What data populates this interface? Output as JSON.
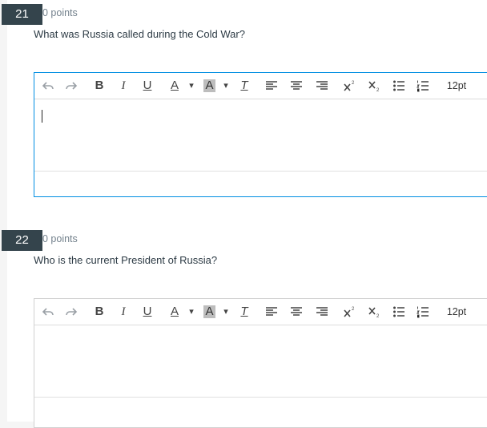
{
  "questions": [
    {
      "number": "21",
      "points": "0 points",
      "text": "What was Russia called during the Cold War?"
    },
    {
      "number": "22",
      "points": "0 points",
      "text": "Who is the current President of Russia?"
    }
  ],
  "toolbar": {
    "bold": "B",
    "italic": "I",
    "underline": "U",
    "font_color": "A",
    "background_color": "A",
    "dropdown_arrow": "▾",
    "clear_formatting": "T",
    "font_size": "12pt",
    "icons": [
      "undo-icon",
      "redo-icon",
      "align-left-icon",
      "align-center-icon",
      "align-right-icon",
      "superscript-icon",
      "subscript-icon",
      "bullet-list-icon",
      "numbered-list-icon"
    ]
  },
  "colors": {
    "active_border": "#008ee2",
    "badge_bg": "#34444c"
  }
}
